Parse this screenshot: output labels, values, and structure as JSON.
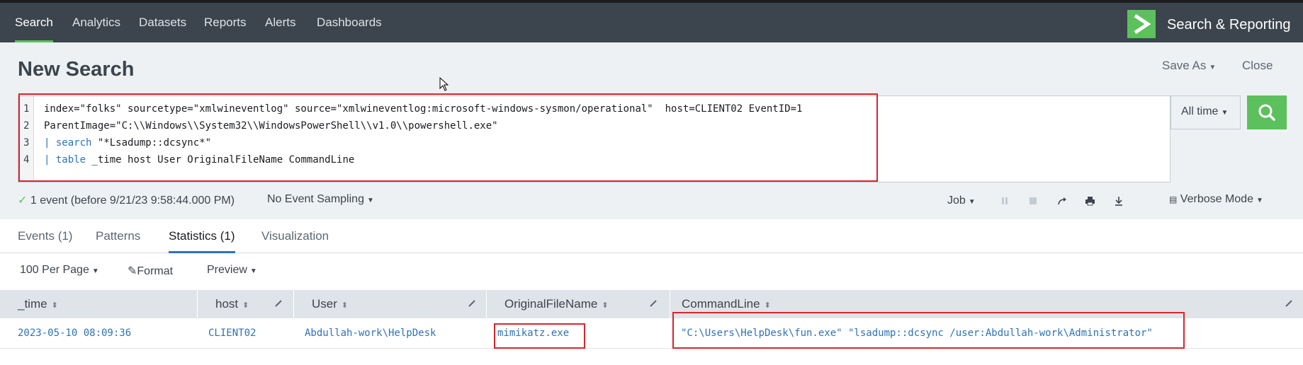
{
  "nav": {
    "items": [
      "Search",
      "Analytics",
      "Datasets",
      "Reports",
      "Alerts",
      "Dashboards"
    ],
    "app_title": "Search & Reporting"
  },
  "page": {
    "title": "New Search",
    "save_as": "Save As",
    "close": "Close"
  },
  "query": {
    "line_numbers": [
      "1",
      "2",
      "3",
      "4"
    ],
    "line1": "index=\"folks\" sourcetype=\"xmlwineventlog\" source=\"xmlwineventlog:microsoft-windows-sysmon/operational\"  host=CLIENT02 EventID=1",
    "line2": "ParentImage=\"C:\\\\Windows\\\\System32\\\\WindowsPowerShell\\\\v1.0\\\\powershell.exe\"",
    "line3_pipe": "| ",
    "line3_cmd": "search",
    "line3_rest": " \"*Lsadump::dcsync*\"",
    "line4_pipe": "| ",
    "line4_cmd": "table",
    "line4_rest": " _time host User OriginalFileName CommandLine",
    "time_range": "All time"
  },
  "status": {
    "event_summary": "1 event (before 9/21/23 9:58:44.000 PM)",
    "sampling": "No Event Sampling",
    "job": "Job",
    "mode": "Verbose Mode"
  },
  "tabs": [
    "Events (1)",
    "Patterns",
    "Statistics (1)",
    "Visualization"
  ],
  "toolbar": {
    "per_page": "100 Per Page",
    "format": "Format",
    "preview": "Preview"
  },
  "table": {
    "columns": [
      "_time",
      "host",
      "User",
      "OriginalFileName",
      "CommandLine"
    ],
    "rows": [
      [
        "2023-05-10 08:09:36",
        "CLIENT02",
        "Abdullah-work\\HelpDesk",
        "mimikatz.exe",
        "\"C:\\Users\\HelpDesk\\fun.exe\" \"lsadump::dcsync /user:Abdullah-work\\Administrator\""
      ]
    ]
  },
  "colors": {
    "nav_bg": "#3c444d",
    "accent_green": "#5cc05c",
    "link_blue": "#2e72b9",
    "highlight_red": "#d8262e"
  }
}
